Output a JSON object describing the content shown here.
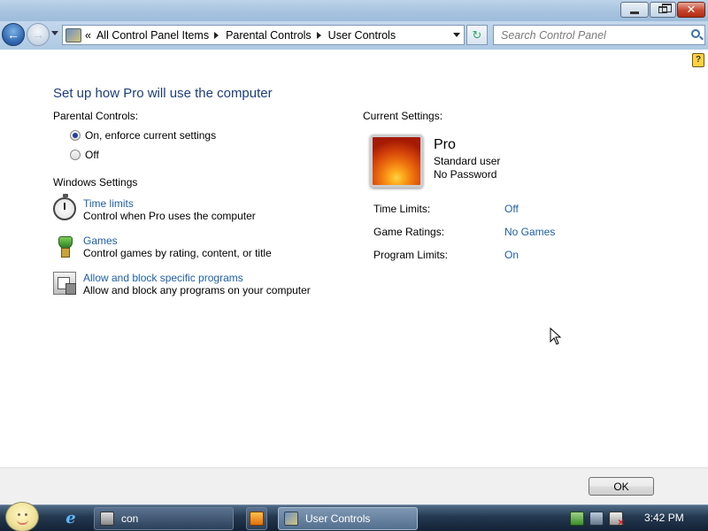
{
  "window": {
    "caption_buttons": {
      "minimize": "minimize",
      "maximize": "restore",
      "close": "close"
    }
  },
  "nav": {
    "breadcrumb_prefix": "«",
    "breadcrumbs": [
      "All Control Panel Items",
      "Parental Controls",
      "User Controls"
    ],
    "search_placeholder": "Search Control Panel",
    "refresh_glyph": "↻"
  },
  "help_glyph": "?",
  "page": {
    "heading": "Set up how Pro will use the computer",
    "parental_controls_label": "Parental Controls:",
    "radio_on_label": "On, enforce current settings",
    "radio_off_label": "Off",
    "windows_settings_label": "Windows Settings",
    "settings": [
      {
        "link": "Time limits",
        "description": "Control when Pro uses the computer",
        "icon": "stopwatch-icon"
      },
      {
        "link": "Games",
        "description": "Control games by rating, content, or title",
        "icon": "game-trophy-icon"
      },
      {
        "link": "Allow and block specific programs",
        "description": "Allow and block any programs on your computer",
        "icon": "programs-icon"
      }
    ]
  },
  "current_settings": {
    "label": "Current Settings:",
    "user_name": "Pro",
    "user_type": "Standard user",
    "password_status": "No Password",
    "rows": [
      {
        "label": "Time Limits:",
        "value": "Off"
      },
      {
        "label": "Game Ratings:",
        "value": "No Games"
      },
      {
        "label": "Program Limits:",
        "value": "On"
      }
    ]
  },
  "footer": {
    "ok_label": "OK"
  },
  "taskbar": {
    "tasks": [
      {
        "label": "con",
        "icon": "console-icon"
      },
      {
        "label": "",
        "icon": "media-player-icon"
      },
      {
        "label": "User Controls",
        "icon": "control-panel-icon"
      }
    ],
    "ie_glyph": "e",
    "clock": "3:42 PM"
  }
}
